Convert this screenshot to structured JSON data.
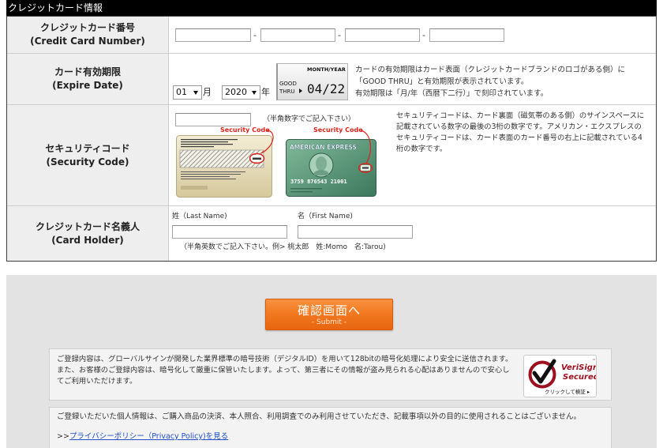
{
  "page": {
    "header_title": "クレジットカード情報"
  },
  "card_number": {
    "label_ja": "クレジットカード番号",
    "label_en": "(Credit Card Number)",
    "separator": "-",
    "fields": [
      {
        "value": "",
        "placeholder": ""
      },
      {
        "value": "",
        "placeholder": ""
      },
      {
        "value": "",
        "placeholder": ""
      },
      {
        "value": "",
        "placeholder": ""
      }
    ]
  },
  "expire": {
    "label_ja": "カード有効期限",
    "label_en": "(Expire Date)",
    "month": {
      "selected": "01",
      "unit": "月"
    },
    "year": {
      "selected": "2020",
      "unit": "年"
    },
    "card_sample": {
      "month_year": "MONTH/YEAR",
      "good": "GOOD",
      "thru": "THRU",
      "date": "04/22"
    },
    "notes": [
      "カードの有効期限はカード表面（クレジットカードブランドのロゴがある側）に",
      "「GOOD THRU」と有効期限が表示されています。",
      "有効期限は「月/年（西暦下二行）」で刻印されています。"
    ]
  },
  "security": {
    "label_ja": "セキュリティコード",
    "label_en": "(Security Code)",
    "field": {
      "value": "",
      "placeholder": ""
    },
    "hint": "（半角数字でご記入下さい）",
    "callout": "Security Code",
    "card_front": {
      "brand": "AMERICAN EXPRESS",
      "number": "3759 876543 21001"
    },
    "notes": [
      "セキュリティコードは、カード裏面（磁気帯のある側）のサインスペースに",
      "記載されている数字の最後の3桁の数字です。アメリカン・エクスプレスの",
      "セキュリティコードは、カード表面のカード番号の右上に記載されている4",
      "桁の数字です。"
    ]
  },
  "holder": {
    "label_ja": "クレジットカード名義人",
    "label_en": "(Card Holder)",
    "last_name_label": "姓（Last Name)",
    "first_name_label": "名（First Name)",
    "last_name": {
      "value": "",
      "placeholder": ""
    },
    "first_name": {
      "value": "",
      "placeholder": ""
    },
    "note": "（半角英数でご記入下さい。例> 桃太郎　姓:Momo　名:Tarou)"
  },
  "submit": {
    "label": "確認画面へ",
    "sublabel": "- Submit -"
  },
  "notice": {
    "lines": [
      "ご登録内容は、グローバルサインが開発した業界標準の暗号技術（デジタルID）を用いて128bitの暗号化処理により安全に送信されます。",
      "また、お客様のご登録内容は、暗号化して厳重に保管いたします。よって、第三者にその情報が盗み見られる心配はありませんので安心し",
      "てご利用いただけます。"
    ]
  },
  "badge": {
    "name": "VeriSign",
    "tm": "™",
    "status": "Secured",
    "action": "クリックして検証 ▸"
  },
  "privacy": {
    "text": "ご登録いただいた個人情報は、ご購入商品の決済、本人照合、利用調査でのみ利用させていただき、記載事項以外の目的に使用されることはございません。",
    "link_prefix": ">>",
    "link_label": "プライバシーポリシー（Privacy Policy)を見る"
  },
  "icons": {
    "select_arrow": "dropdown-arrow-icon",
    "good_thru_arrow": "arrow-right-icon",
    "badge_check": "check-circle-icon"
  },
  "colors": {
    "header_bg": "#000000",
    "accent": "#f27a22",
    "accent_dark": "#d45d0c",
    "callout": "#d9261c",
    "link": "#1f4fc7",
    "badge_red": "#9b0f1f",
    "label_bg": "#eeeeee",
    "panel_bg": "#f3f3f3",
    "area_bg": "#e3e3e3"
  }
}
